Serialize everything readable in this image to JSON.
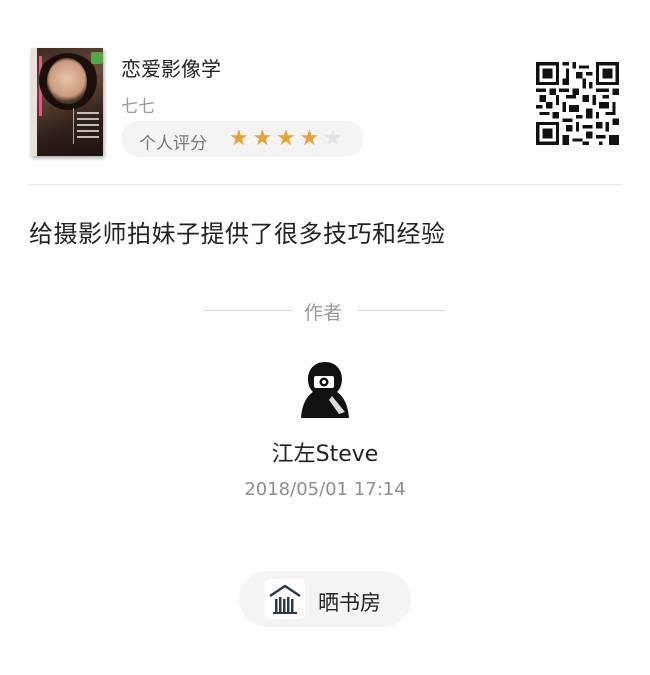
{
  "book": {
    "title": "恋爱影像学",
    "author": "七七",
    "rating_label": "个人评分",
    "rating": 4,
    "rating_max": 5
  },
  "review": {
    "text": "给摄影师拍妹子提供了很多技巧和经验"
  },
  "author_section": {
    "label": "作者",
    "name": "江左Steve",
    "date": "2018/05/01  17:14"
  },
  "share": {
    "label": "晒书房",
    "icon": "bookshelf-icon"
  },
  "colors": {
    "star_on": "#e4a33b",
    "star_off": "#e3e3e3",
    "pill_bg": "#f4f4f4"
  }
}
